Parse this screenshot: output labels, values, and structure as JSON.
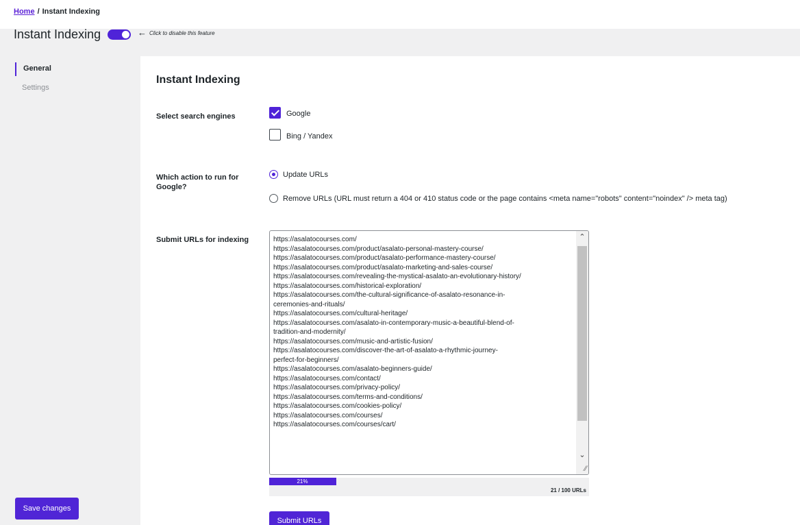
{
  "breadcrumb": {
    "home": "Home",
    "separator": "/",
    "current": "Instant Indexing"
  },
  "header": {
    "title": "Instant Indexing",
    "toggle_on": true,
    "arrow": "←",
    "hint": "Click to disable this feature"
  },
  "sidebar": {
    "items": [
      {
        "label": "General",
        "active": true
      },
      {
        "label": "Settings",
        "active": false
      }
    ],
    "save_label": "Save changes"
  },
  "main": {
    "title": "Instant Indexing",
    "engines": {
      "label": "Select search engines",
      "options": [
        {
          "label": "Google",
          "checked": true
        },
        {
          "label": "Bing / Yandex",
          "checked": false
        }
      ]
    },
    "action": {
      "label": "Which action to run for Google?",
      "options": [
        {
          "label": "Update URLs",
          "selected": true
        },
        {
          "label": "Remove URLs (URL must return a 404 or 410 status code or the page contains <meta name=\"robots\" content=\"noindex\" /> meta tag)",
          "selected": false
        }
      ]
    },
    "urls": {
      "label": "Submit URLs for indexing",
      "lines": [
        "https://asalatocourses.com/",
        "https://asalatocourses.com/product/asalato-personal-mastery-course/",
        "https://asalatocourses.com/product/asalato-performance-mastery-course/",
        "https://asalatocourses.com/product/asalato-marketing-and-sales-course/",
        "https://asalatocourses.com/revealing-the-mystical-asalato-an-evolutionary-history/",
        "https://asalatocourses.com/historical-exploration/",
        "https://asalatocourses.com/the-cultural-significance-of-asalato-resonance-in-",
        "ceremonies-and-rituals/",
        "https://asalatocourses.com/cultural-heritage/",
        "https://asalatocourses.com/asalato-in-contemporary-music-a-beautiful-blend-of-",
        "tradition-and-modernity/",
        "https://asalatocourses.com/music-and-artistic-fusion/",
        "https://asalatocourses.com/discover-the-art-of-asalato-a-rhythmic-journey-",
        "perfect-for-beginners/",
        "https://asalatocourses.com/asalato-beginners-guide/",
        "https://asalatocourses.com/contact/",
        "https://asalatocourses.com/privacy-policy/",
        "https://asalatocourses.com/terms-and-conditions/",
        "https://asalatocourses.com/cookies-policy/",
        "https://asalatocourses.com/courses/",
        "https://asalatocourses.com/courses/cart/"
      ]
    },
    "progress": {
      "percent_label": "21%",
      "fraction": 0.21,
      "count": "21 / 100 URLs"
    },
    "submit_label": "Submit URLs"
  },
  "colors": {
    "accent": "#4f23d8",
    "link": "#5b21d6"
  },
  "icons": {
    "scroll_up": "chevron-up-icon",
    "scroll_down": "chevron-down-icon",
    "resize": "resize-grip-icon",
    "arrow": "arrow-left-icon"
  }
}
